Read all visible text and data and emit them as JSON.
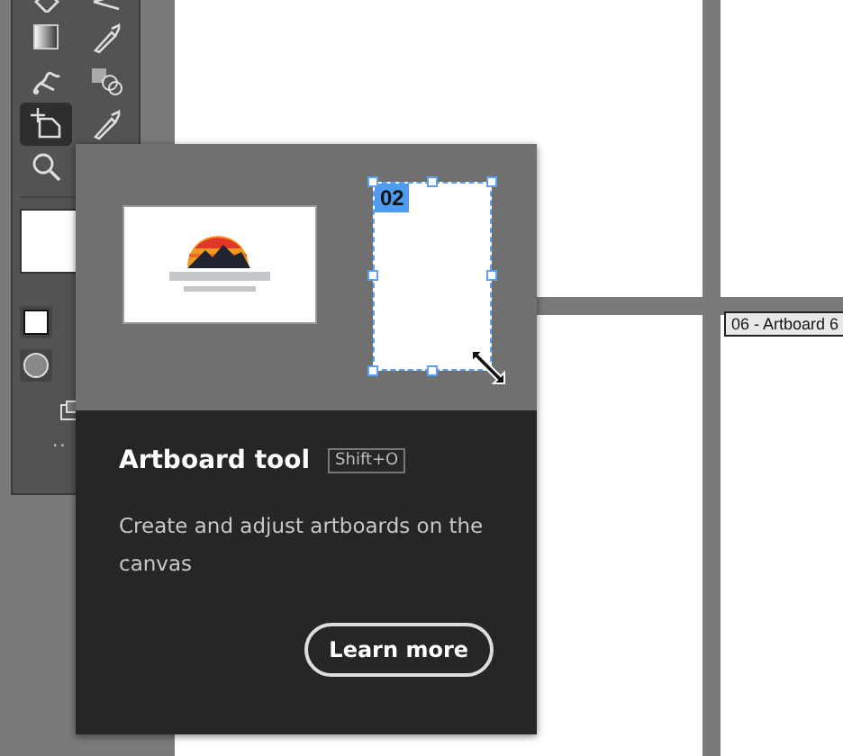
{
  "toolbar": {
    "tools": [
      {
        "kind": "eraser",
        "selected": false
      },
      {
        "kind": "pen-tip",
        "selected": false
      },
      {
        "kind": "gradient",
        "selected": false
      },
      {
        "kind": "eyedropper",
        "selected": false
      },
      {
        "kind": "puppet",
        "selected": false
      },
      {
        "kind": "shapes",
        "selected": false
      },
      {
        "kind": "artboard",
        "selected": true
      },
      {
        "kind": "eyedropper",
        "selected": false
      },
      {
        "kind": "zoom",
        "selected": false
      }
    ],
    "more": ".."
  },
  "canvas": {
    "artboard_label": "06 - Artboard 6"
  },
  "tooltip": {
    "artboard_number": "02",
    "title": "Artboard tool",
    "shortcut": "Shift+O",
    "description": "Create and adjust artboards on the canvas",
    "button": "Learn more"
  }
}
